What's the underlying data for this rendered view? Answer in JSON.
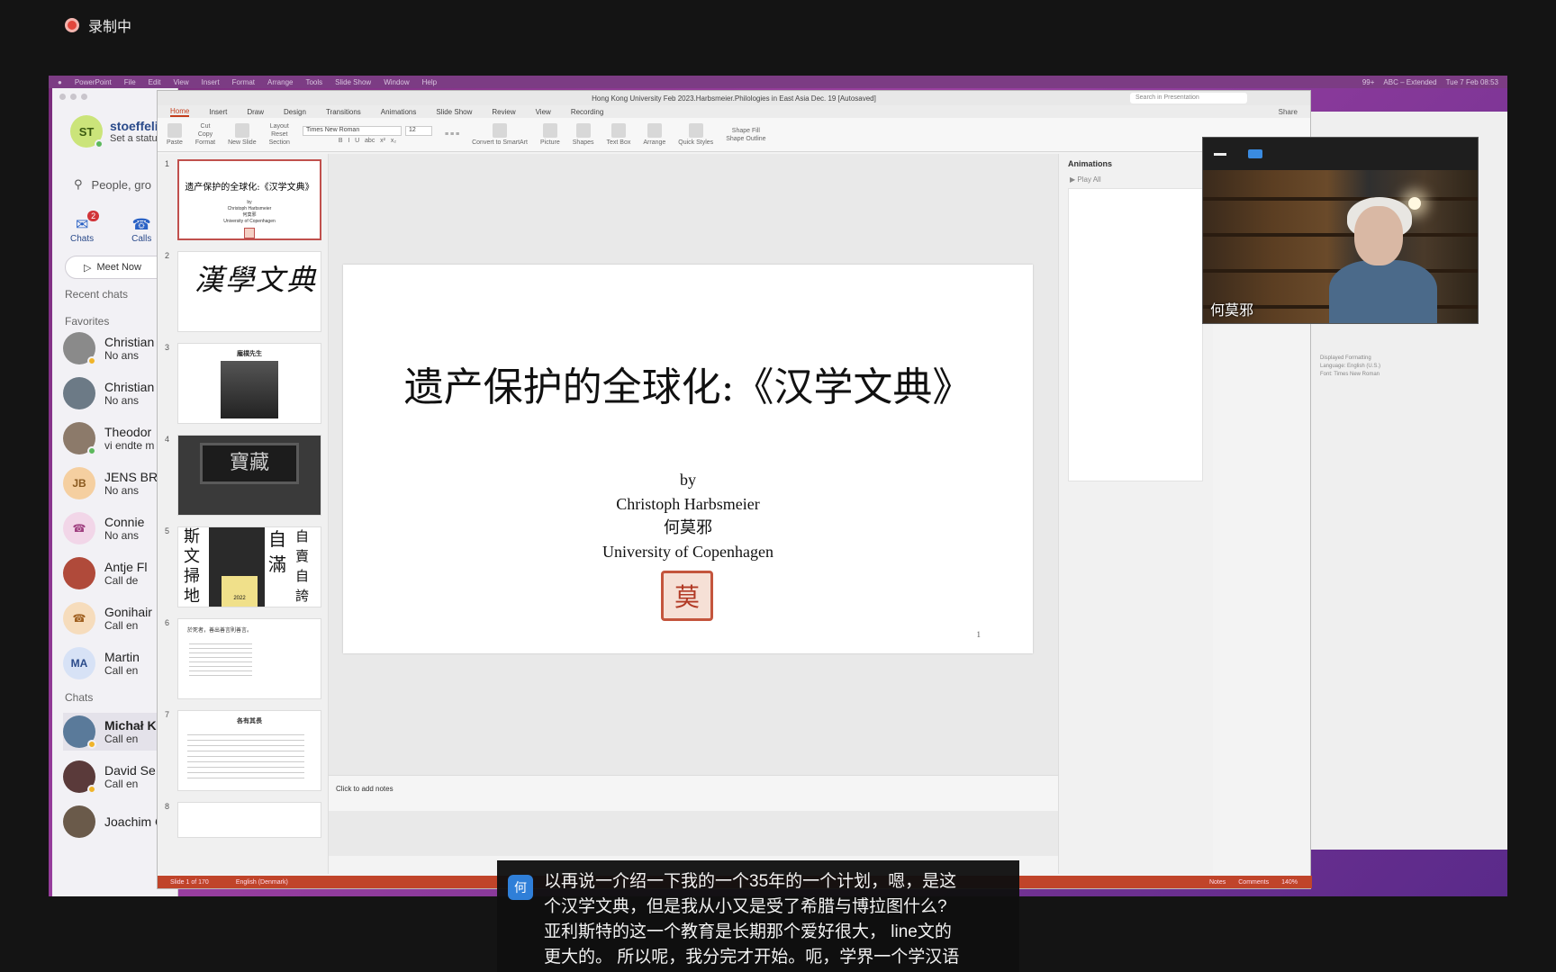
{
  "recording": {
    "label": "录制中"
  },
  "menubar": {
    "items": [
      "PowerPoint",
      "File",
      "Edit",
      "View",
      "Insert",
      "Format",
      "Arrange",
      "Tools",
      "Slide Show",
      "Window",
      "Help"
    ],
    "right": [
      "99+",
      "ABC – Extended",
      "Tue 7 Feb 08:53"
    ]
  },
  "teams": {
    "profile": {
      "initials": "ST",
      "name": "stoeffelin",
      "status": "Set a status"
    },
    "search_placeholder": "People, gro",
    "nav": [
      {
        "label": "Chats",
        "badge": "2"
      },
      {
        "label": "Calls"
      }
    ],
    "meet_now": "Meet Now",
    "recent_chats": "Recent chats",
    "favorites": "Favorites",
    "chats_label": "Chats",
    "contacts": [
      {
        "name": "Christian",
        "status": "No ans"
      },
      {
        "name": "Christian",
        "status": "No ans"
      },
      {
        "name": "Theodor",
        "status": "vi endte m"
      },
      {
        "name": "JENS BRA",
        "status": "No ans",
        "initials": "JB"
      },
      {
        "name": "Connie",
        "status": "No ans"
      },
      {
        "name": "Antje Fl",
        "status": "Call de"
      },
      {
        "name": "Gonihair",
        "status": "Call en"
      },
      {
        "name": "Martin",
        "status": "Call en",
        "initials": "MA"
      },
      {
        "name": "Michał K",
        "status": "Call en"
      },
      {
        "name": "David Se",
        "status": "Call en"
      },
      {
        "name": "Joachim Gentz",
        "status": ""
      }
    ]
  },
  "ppt": {
    "window_title": "Hong Kong University Feb 2023.Harbsmeier.Philologies in East Asia Dec. 19 [Autosaved]",
    "search_placeholder": "Search in Presentation",
    "tabs": [
      "Home",
      "Insert",
      "Draw",
      "Design",
      "Transitions",
      "Animations",
      "Slide Show",
      "Review",
      "View",
      "Recording"
    ],
    "share": "Share",
    "ribbon": {
      "paste": "Paste",
      "cut": "Cut",
      "copy": "Copy",
      "format": "Format",
      "new_slide": "New Slide",
      "layout": "Layout",
      "reset": "Reset",
      "section": "Section",
      "font": "Times New Roman",
      "size": "12",
      "convert": "Convert to SmartArt",
      "picture": "Picture",
      "shapes": "Shapes",
      "textbox": "Text Box",
      "arrange": "Arrange",
      "quick_styles": "Quick Styles",
      "shape_fill": "Shape Fill",
      "shape_outline": "Shape Outline"
    },
    "thumbs": [
      {
        "num": "1",
        "title": "遗产保护的全球化:《汉学文典》",
        "lines": [
          "by",
          "Christoph Harbsmeier",
          "何莫邪",
          "University of Copenhagen"
        ]
      },
      {
        "num": "2",
        "title": "漢學文典"
      },
      {
        "num": "3",
        "title": "龐樸先生"
      },
      {
        "num": "4",
        "title": "寶藏"
      },
      {
        "num": "5",
        "left": "斯文掃地",
        "right1": "自滿",
        "right2": "自賣自誇",
        "year": "2022"
      },
      {
        "num": "6",
        "title": "於死者，善出善言則善言。"
      },
      {
        "num": "7",
        "title": "各有其長"
      },
      {
        "num": "8"
      }
    ],
    "slide": {
      "title": "遗产保护的全球化:《汉学文典》",
      "by": "by",
      "author": "Christoph Harbsmeier",
      "chinese_name": "何莫邪",
      "university": "University of Copenhagen",
      "seal": "莫",
      "page": "1"
    },
    "notes_placeholder": "Click to add notes",
    "animations": {
      "title": "Animations",
      "play_all": "Play All"
    },
    "status": {
      "slide": "Slide 1 of 170",
      "language": "English (Denmark)",
      "notes": "Notes",
      "comments": "Comments",
      "zoom": "140%"
    }
  },
  "right_app": {
    "formatting": "Displayed Formatting",
    "language": "Language: English (U.S.)",
    "font": "Font: Times New Roman"
  },
  "video": {
    "name": "何莫邪"
  },
  "caption": {
    "avatar": "何",
    "lines": [
      "以再说一介绍一下我的一个35年的一个计划，嗯，是这",
      "个汉学文典，但是我从小又是受了希腊与博拉图什么?",
      "亚利斯特的这一个教育是长期那个爱好很大， line文的",
      "更大的。 所以呢，我分完才开始。呃，学界一个学汉语"
    ]
  }
}
